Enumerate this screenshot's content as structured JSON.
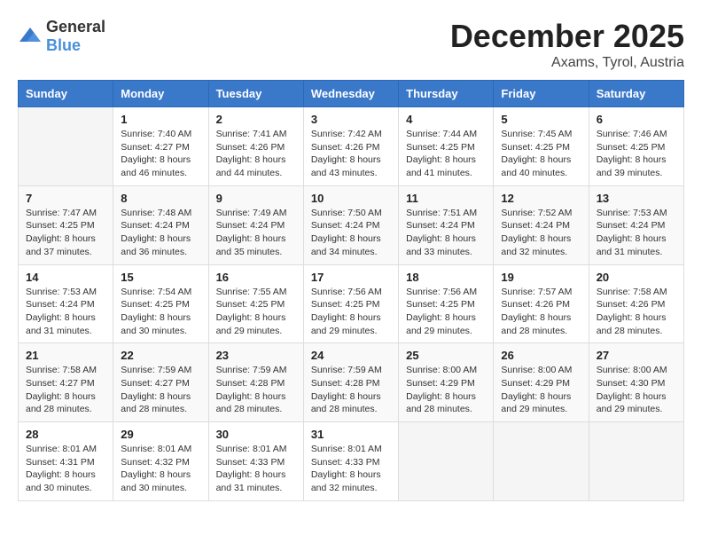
{
  "logo": {
    "general": "General",
    "blue": "Blue"
  },
  "title": {
    "month": "December 2025",
    "location": "Axams, Tyrol, Austria"
  },
  "days_of_week": [
    "Sunday",
    "Monday",
    "Tuesday",
    "Wednesday",
    "Thursday",
    "Friday",
    "Saturday"
  ],
  "weeks": [
    [
      {
        "day": "",
        "info": ""
      },
      {
        "day": "1",
        "info": "Sunrise: 7:40 AM\nSunset: 4:27 PM\nDaylight: 8 hours\nand 46 minutes."
      },
      {
        "day": "2",
        "info": "Sunrise: 7:41 AM\nSunset: 4:26 PM\nDaylight: 8 hours\nand 44 minutes."
      },
      {
        "day": "3",
        "info": "Sunrise: 7:42 AM\nSunset: 4:26 PM\nDaylight: 8 hours\nand 43 minutes."
      },
      {
        "day": "4",
        "info": "Sunrise: 7:44 AM\nSunset: 4:25 PM\nDaylight: 8 hours\nand 41 minutes."
      },
      {
        "day": "5",
        "info": "Sunrise: 7:45 AM\nSunset: 4:25 PM\nDaylight: 8 hours\nand 40 minutes."
      },
      {
        "day": "6",
        "info": "Sunrise: 7:46 AM\nSunset: 4:25 PM\nDaylight: 8 hours\nand 39 minutes."
      }
    ],
    [
      {
        "day": "7",
        "info": "Sunrise: 7:47 AM\nSunset: 4:25 PM\nDaylight: 8 hours\nand 37 minutes."
      },
      {
        "day": "8",
        "info": "Sunrise: 7:48 AM\nSunset: 4:24 PM\nDaylight: 8 hours\nand 36 minutes."
      },
      {
        "day": "9",
        "info": "Sunrise: 7:49 AM\nSunset: 4:24 PM\nDaylight: 8 hours\nand 35 minutes."
      },
      {
        "day": "10",
        "info": "Sunrise: 7:50 AM\nSunset: 4:24 PM\nDaylight: 8 hours\nand 34 minutes."
      },
      {
        "day": "11",
        "info": "Sunrise: 7:51 AM\nSunset: 4:24 PM\nDaylight: 8 hours\nand 33 minutes."
      },
      {
        "day": "12",
        "info": "Sunrise: 7:52 AM\nSunset: 4:24 PM\nDaylight: 8 hours\nand 32 minutes."
      },
      {
        "day": "13",
        "info": "Sunrise: 7:53 AM\nSunset: 4:24 PM\nDaylight: 8 hours\nand 31 minutes."
      }
    ],
    [
      {
        "day": "14",
        "info": "Sunrise: 7:53 AM\nSunset: 4:24 PM\nDaylight: 8 hours\nand 31 minutes."
      },
      {
        "day": "15",
        "info": "Sunrise: 7:54 AM\nSunset: 4:25 PM\nDaylight: 8 hours\nand 30 minutes."
      },
      {
        "day": "16",
        "info": "Sunrise: 7:55 AM\nSunset: 4:25 PM\nDaylight: 8 hours\nand 29 minutes."
      },
      {
        "day": "17",
        "info": "Sunrise: 7:56 AM\nSunset: 4:25 PM\nDaylight: 8 hours\nand 29 minutes."
      },
      {
        "day": "18",
        "info": "Sunrise: 7:56 AM\nSunset: 4:25 PM\nDaylight: 8 hours\nand 29 minutes."
      },
      {
        "day": "19",
        "info": "Sunrise: 7:57 AM\nSunset: 4:26 PM\nDaylight: 8 hours\nand 28 minutes."
      },
      {
        "day": "20",
        "info": "Sunrise: 7:58 AM\nSunset: 4:26 PM\nDaylight: 8 hours\nand 28 minutes."
      }
    ],
    [
      {
        "day": "21",
        "info": "Sunrise: 7:58 AM\nSunset: 4:27 PM\nDaylight: 8 hours\nand 28 minutes."
      },
      {
        "day": "22",
        "info": "Sunrise: 7:59 AM\nSunset: 4:27 PM\nDaylight: 8 hours\nand 28 minutes."
      },
      {
        "day": "23",
        "info": "Sunrise: 7:59 AM\nSunset: 4:28 PM\nDaylight: 8 hours\nand 28 minutes."
      },
      {
        "day": "24",
        "info": "Sunrise: 7:59 AM\nSunset: 4:28 PM\nDaylight: 8 hours\nand 28 minutes."
      },
      {
        "day": "25",
        "info": "Sunrise: 8:00 AM\nSunset: 4:29 PM\nDaylight: 8 hours\nand 28 minutes."
      },
      {
        "day": "26",
        "info": "Sunrise: 8:00 AM\nSunset: 4:29 PM\nDaylight: 8 hours\nand 29 minutes."
      },
      {
        "day": "27",
        "info": "Sunrise: 8:00 AM\nSunset: 4:30 PM\nDaylight: 8 hours\nand 29 minutes."
      }
    ],
    [
      {
        "day": "28",
        "info": "Sunrise: 8:01 AM\nSunset: 4:31 PM\nDaylight: 8 hours\nand 30 minutes."
      },
      {
        "day": "29",
        "info": "Sunrise: 8:01 AM\nSunset: 4:32 PM\nDaylight: 8 hours\nand 30 minutes."
      },
      {
        "day": "30",
        "info": "Sunrise: 8:01 AM\nSunset: 4:33 PM\nDaylight: 8 hours\nand 31 minutes."
      },
      {
        "day": "31",
        "info": "Sunrise: 8:01 AM\nSunset: 4:33 PM\nDaylight: 8 hours\nand 32 minutes."
      },
      {
        "day": "",
        "info": ""
      },
      {
        "day": "",
        "info": ""
      },
      {
        "day": "",
        "info": ""
      }
    ]
  ]
}
